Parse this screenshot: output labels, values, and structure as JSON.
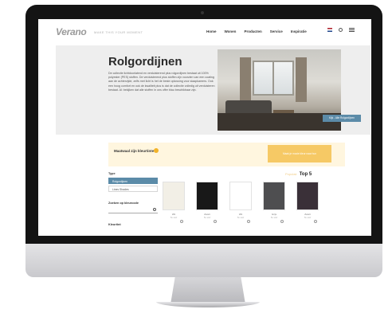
{
  "nav": {
    "logo": "Verano",
    "tagline": "MAKE THIS YOUR MOMENT",
    "menu": [
      "Home",
      "Wonen",
      "Producten",
      "Service",
      "Inspiratie"
    ]
  },
  "hero": {
    "title": "Rolgordijnen",
    "text": "De collectie lichtdoorlatend en verduisterend plus rolgordijnen bestaat uit 100% polyester (PES) stoffen. De verduisterend plus stoffen zijn voorzien van een coating aan de achterzijde, zelfs met licht is het de beste oplossing voor slaapkamers. Ook een hoog comfort en ook de kwaliteit plus is dat de collectie volledig uit verduisteren bestaat. Al: bekijken dat alle stoffen in ons offer blau beschikbaar zijn.",
    "button_label": "Kijk - Alle Rolgordijnen"
  },
  "results": {
    "title": "Maatwaal zijn kleurtinten",
    "cta_label": "Maak je mooie kleur naar hun"
  },
  "filters": {
    "type_heading": "Type",
    "options": [
      "Rolgordijnen",
      "Lines Shades"
    ],
    "search_heading": "Zoeken op kleurcode",
    "colour_heading": "Kleurtint"
  },
  "grid": {
    "muted_label": "Populair",
    "heading": "Top 5"
  },
  "products": [
    {
      "name": "Wit",
      "meta": "5x stof",
      "color": "#f2efe6"
    },
    {
      "name": "Zwart",
      "meta": "5x stof",
      "color": "#181818"
    },
    {
      "name": "Wit",
      "meta": "5x stof",
      "color": "#ffffff"
    },
    {
      "name": "Grijs",
      "meta": "5x stof",
      "color": "#4e4e50"
    },
    {
      "name": "Zwart",
      "meta": "5x stof",
      "color": "#3a3038"
    }
  ],
  "colors": {
    "accent": "#5b8ba8",
    "results_background": "#fff6df",
    "cta": "#f6c965",
    "badge": "#f2b32a"
  }
}
